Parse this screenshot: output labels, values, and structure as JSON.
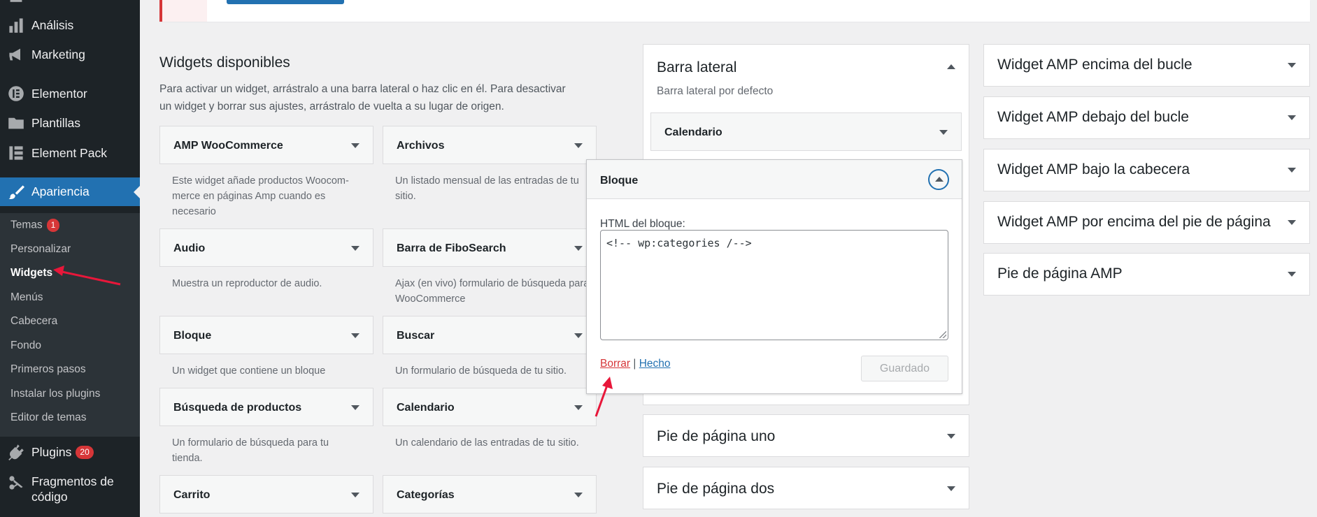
{
  "sidebar": {
    "menu": [
      {
        "label": "Análisis",
        "icon": "bar-chart-icon"
      },
      {
        "label": "Marketing",
        "icon": "megaphone-icon"
      },
      {
        "label": "Elementor",
        "icon": "elementor-icon"
      },
      {
        "label": "Plantillas",
        "icon": "folder-icon"
      },
      {
        "label": "Element Pack",
        "icon": "element-pack-icon"
      },
      {
        "label": "Apariencia",
        "icon": "paintbrush-icon"
      },
      {
        "label": "Plugins",
        "icon": "plug-icon",
        "badge": "20"
      },
      {
        "label": "Fragmentos de código",
        "icon": "scissors-icon"
      }
    ],
    "submenu": [
      {
        "label": "Temas",
        "badge": "1"
      },
      {
        "label": "Personalizar"
      },
      {
        "label": "Widgets",
        "current": true
      },
      {
        "label": "Menús"
      },
      {
        "label": "Cabecera"
      },
      {
        "label": "Fondo"
      },
      {
        "label": "Primeros pasos"
      },
      {
        "label": "Instalar los plugins"
      },
      {
        "label": "Editor de temas"
      }
    ]
  },
  "available": {
    "title": "Widgets disponibles",
    "description": "Para activar un widget, arrástralo a una barra lateral o haz clic en él. Para desactivar un widget y borrar sus ajustes, arrástralo de vuelta a su lugar de origen.",
    "widgets": [
      {
        "name": "AMP WooCommerce",
        "desc": "Este widget añade productos Woocom-merce en páginas Amp cuando es necesario"
      },
      {
        "name": "Archivos",
        "desc": "Un listado mensual de las entradas de tu sitio."
      },
      {
        "name": "Audio",
        "desc": "Muestra un reproductor de audio."
      },
      {
        "name": "Barra de FiboSearch",
        "desc": "Ajax (en vivo) formulario de búsqueda para WooCommerce"
      },
      {
        "name": "Bloque",
        "desc": "Un widget que contiene un bloque"
      },
      {
        "name": "Buscar",
        "desc": "Un formulario de búsqueda de tu sitio."
      },
      {
        "name": "Búsqueda de productos",
        "desc": "Un formulario de búsqueda para tu tienda."
      },
      {
        "name": "Calendario",
        "desc": "Un calendario de las entradas de tu sitio."
      },
      {
        "name": "Carrito",
        "desc": ""
      },
      {
        "name": "Categorías",
        "desc": ""
      }
    ]
  },
  "sidebar_area": {
    "title": "Barra lateral",
    "description": "Barra lateral por defecto",
    "widgets": [
      "Calendario"
    ]
  },
  "bloque_editor": {
    "title": "Bloque",
    "html_label": "HTML del bloque:",
    "html_value": "<!-- wp:categories /-->",
    "delete_link": "Borrar",
    "separator": "|",
    "done_link": "Hecho",
    "save_button": "Guardado"
  },
  "footer_areas": [
    "Pie de página uno",
    "Pie de página dos"
  ],
  "amp_areas": [
    "Widget AMP encima del bucle",
    "Widget AMP debajo del bucle",
    "Widget AMP bajo la cabecera",
    "Widget AMP por encima del pie de página",
    "Pie de página AMP"
  ],
  "colors": {
    "admin_sidebar": "#1d2327",
    "accent": "#2271b1",
    "danger": "#d63638",
    "annotation_arrow": "#e8173a"
  }
}
